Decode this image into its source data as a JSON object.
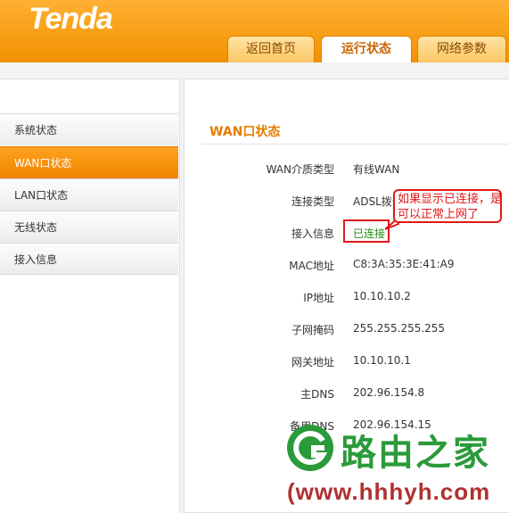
{
  "brand": {
    "logo": "Tenda"
  },
  "nav": {
    "tabs": [
      {
        "label": "返回首页"
      },
      {
        "label": "运行状态"
      },
      {
        "label": "网络参数"
      }
    ]
  },
  "sidebar": {
    "items": [
      {
        "label": "系统状态"
      },
      {
        "label": "WAN口状态"
      },
      {
        "label": "LAN口状态"
      },
      {
        "label": "无线状态"
      },
      {
        "label": "接入信息"
      }
    ]
  },
  "main": {
    "title": "WAN口状态",
    "rows": [
      {
        "label": "WAN介质类型",
        "value": "有线WAN"
      },
      {
        "label": "连接类型",
        "value": "ADSL拨号"
      },
      {
        "label": "接入信息",
        "value": "已连接"
      },
      {
        "label": "MAC地址",
        "value": "C8:3A:35:3E:41:A9"
      },
      {
        "label": "IP地址",
        "value": "10.10.10.2"
      },
      {
        "label": "子网掩码",
        "value": "255.255.255.255"
      },
      {
        "label": "网关地址",
        "value": "10.10.10.1"
      },
      {
        "label": "主DNS",
        "value": "202.96.154.8"
      },
      {
        "label": "备用DNS",
        "value": "202.96.154.15"
      }
    ]
  },
  "annotation": {
    "text": "如果显示已连接，是可以正常上网了"
  },
  "watermark": {
    "brand": "路由之家",
    "url": "(www.hhhyh.com"
  },
  "colors": {
    "accent": "#f29100",
    "connected": "#1e8c14",
    "annotation": "#e01919"
  }
}
